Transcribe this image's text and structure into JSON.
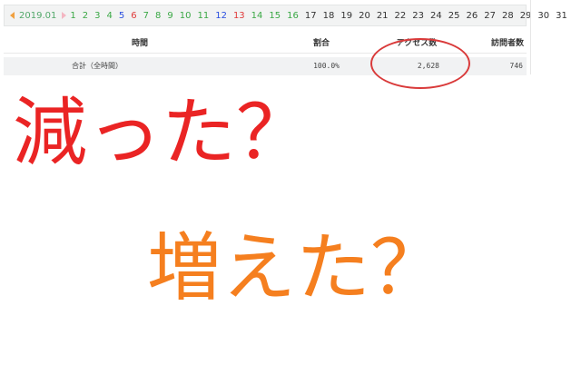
{
  "date_nav": {
    "month_label": "2019.01",
    "days": [
      {
        "label": "1",
        "kind": "weekday"
      },
      {
        "label": "2",
        "kind": "weekday"
      },
      {
        "label": "3",
        "kind": "weekday"
      },
      {
        "label": "4",
        "kind": "weekday"
      },
      {
        "label": "5",
        "kind": "sat"
      },
      {
        "label": "6",
        "kind": "sun"
      },
      {
        "label": "7",
        "kind": "weekday"
      },
      {
        "label": "8",
        "kind": "weekday"
      },
      {
        "label": "9",
        "kind": "weekday"
      },
      {
        "label": "10",
        "kind": "weekday"
      },
      {
        "label": "11",
        "kind": "weekday"
      },
      {
        "label": "12",
        "kind": "sat"
      },
      {
        "label": "13",
        "kind": "sun"
      },
      {
        "label": "14",
        "kind": "weekday"
      },
      {
        "label": "15",
        "kind": "weekday"
      },
      {
        "label": "16",
        "kind": "weekday"
      },
      {
        "label": "17",
        "kind": "future"
      },
      {
        "label": "18",
        "kind": "future"
      },
      {
        "label": "19",
        "kind": "future"
      },
      {
        "label": "20",
        "kind": "future"
      },
      {
        "label": "21",
        "kind": "future"
      },
      {
        "label": "22",
        "kind": "future"
      },
      {
        "label": "23",
        "kind": "future"
      },
      {
        "label": "24",
        "kind": "future"
      },
      {
        "label": "25",
        "kind": "future"
      },
      {
        "label": "26",
        "kind": "future"
      },
      {
        "label": "27",
        "kind": "future"
      },
      {
        "label": "28",
        "kind": "future"
      },
      {
        "label": "29",
        "kind": "future"
      },
      {
        "label": "30",
        "kind": "future"
      },
      {
        "label": "31",
        "kind": "future"
      }
    ]
  },
  "table": {
    "headers": {
      "time": "時間",
      "ratio": "割合",
      "access": "アクセス数",
      "visitors": "訪問者数"
    },
    "rows": [
      {
        "time": "合計（全時間）",
        "ratio": "100.0%",
        "access": "2,628",
        "visitors": "746"
      }
    ]
  },
  "overlay": {
    "text_decreased": "減った？",
    "text_increased": "増えた？",
    "color_red": "#ea2424",
    "color_orange": "#f57f1f"
  }
}
